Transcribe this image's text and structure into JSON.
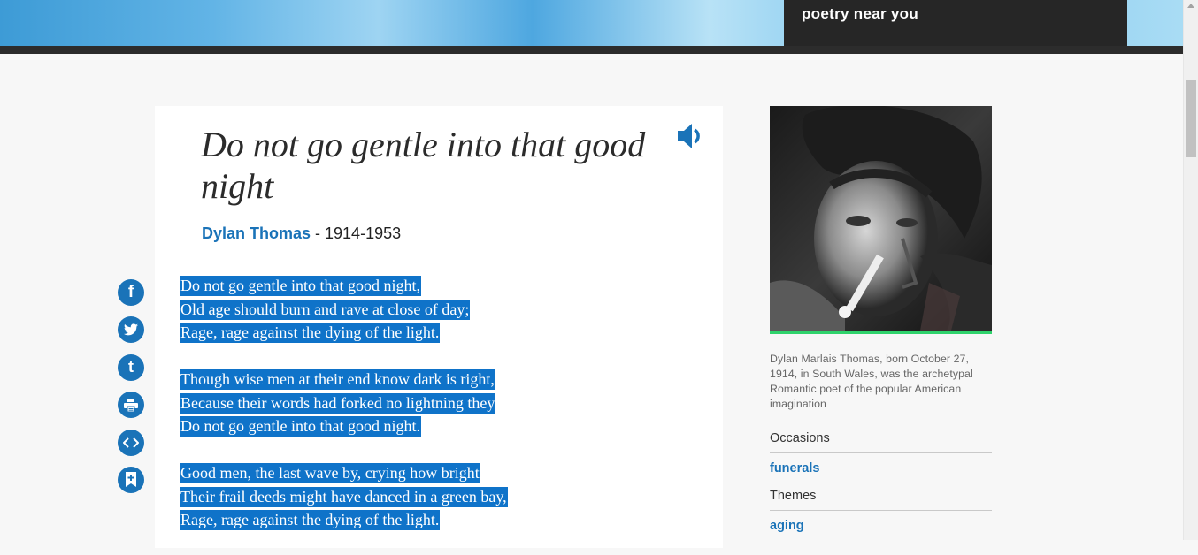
{
  "header": {
    "promo_label": "poetry near you"
  },
  "poem": {
    "title": "Do not go gentle into that good night",
    "author": "Dylan Thomas",
    "dates": " - 1914-1953",
    "stanzas": [
      [
        "Do not go gentle into that good night,",
        "Old age should burn and rave at close of day;",
        "Rage, rage against the dying of the light."
      ],
      [
        "Though wise men at their end know dark is right,",
        "Because their words had forked no lightning they",
        "Do not go gentle into that good night."
      ],
      [
        "Good men, the last wave by, crying how bright",
        "Their frail deeds might have danced in a green bay,",
        "Rage, rage against the dying of the light."
      ]
    ]
  },
  "share": {
    "facebook_glyph": "f",
    "tumblr_glyph": "t"
  },
  "sidebar": {
    "caption": "Dylan Marlais Thomas, born October 27, 1914, in South Wales, was the archetypal Romantic poet of the popular American imagination",
    "occasions_label": "Occasions",
    "occasion_link": "funerals",
    "themes_label": "Themes",
    "theme_link": "aging"
  },
  "colors": {
    "link_blue": "#1a73b8",
    "selection_blue": "#0f73c9",
    "accent_green": "#2fd36c"
  }
}
